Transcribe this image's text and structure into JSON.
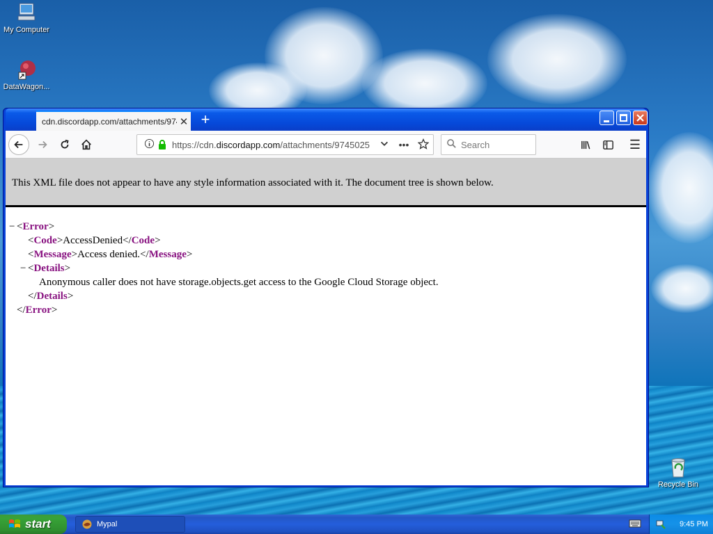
{
  "desktop": {
    "icons": [
      {
        "label": "My Computer",
        "icon": "my-computer-icon"
      },
      {
        "label": "DataWagon...",
        "icon": "datawagon-icon"
      },
      {
        "label": "Recycle Bin",
        "icon": "recycle-bin-icon"
      }
    ]
  },
  "browser": {
    "tab": {
      "title": "cdn.discordapp.com/attachments/9745",
      "close": "✕"
    },
    "new_tab": "+",
    "url": {
      "prefix": "https://cdn.",
      "domain": "discordapp.com",
      "path": "/attachments/9745025"
    },
    "search_placeholder": "Search",
    "menu_glyph": "☰",
    "more_glyph": "•••"
  },
  "page": {
    "header": "This XML file does not appear to have any style information associated with it. The document tree is shown below.",
    "xml": {
      "root_tag": "Error",
      "code_tag": "Code",
      "code_value": "AccessDenied",
      "message_tag": "Message",
      "message_value": "Access denied.",
      "details_tag": "Details",
      "details_value": "Anonymous caller does not have storage.objects.get access to the Google Cloud Storage object."
    }
  },
  "taskbar": {
    "start_label": "start",
    "task_label": "Mypal",
    "clock": "9:45 PM"
  },
  "colors": {
    "xml_tag": "#881280",
    "titlebar": "#0648d8",
    "taskbar": "#245edb",
    "start": "#38a338"
  }
}
